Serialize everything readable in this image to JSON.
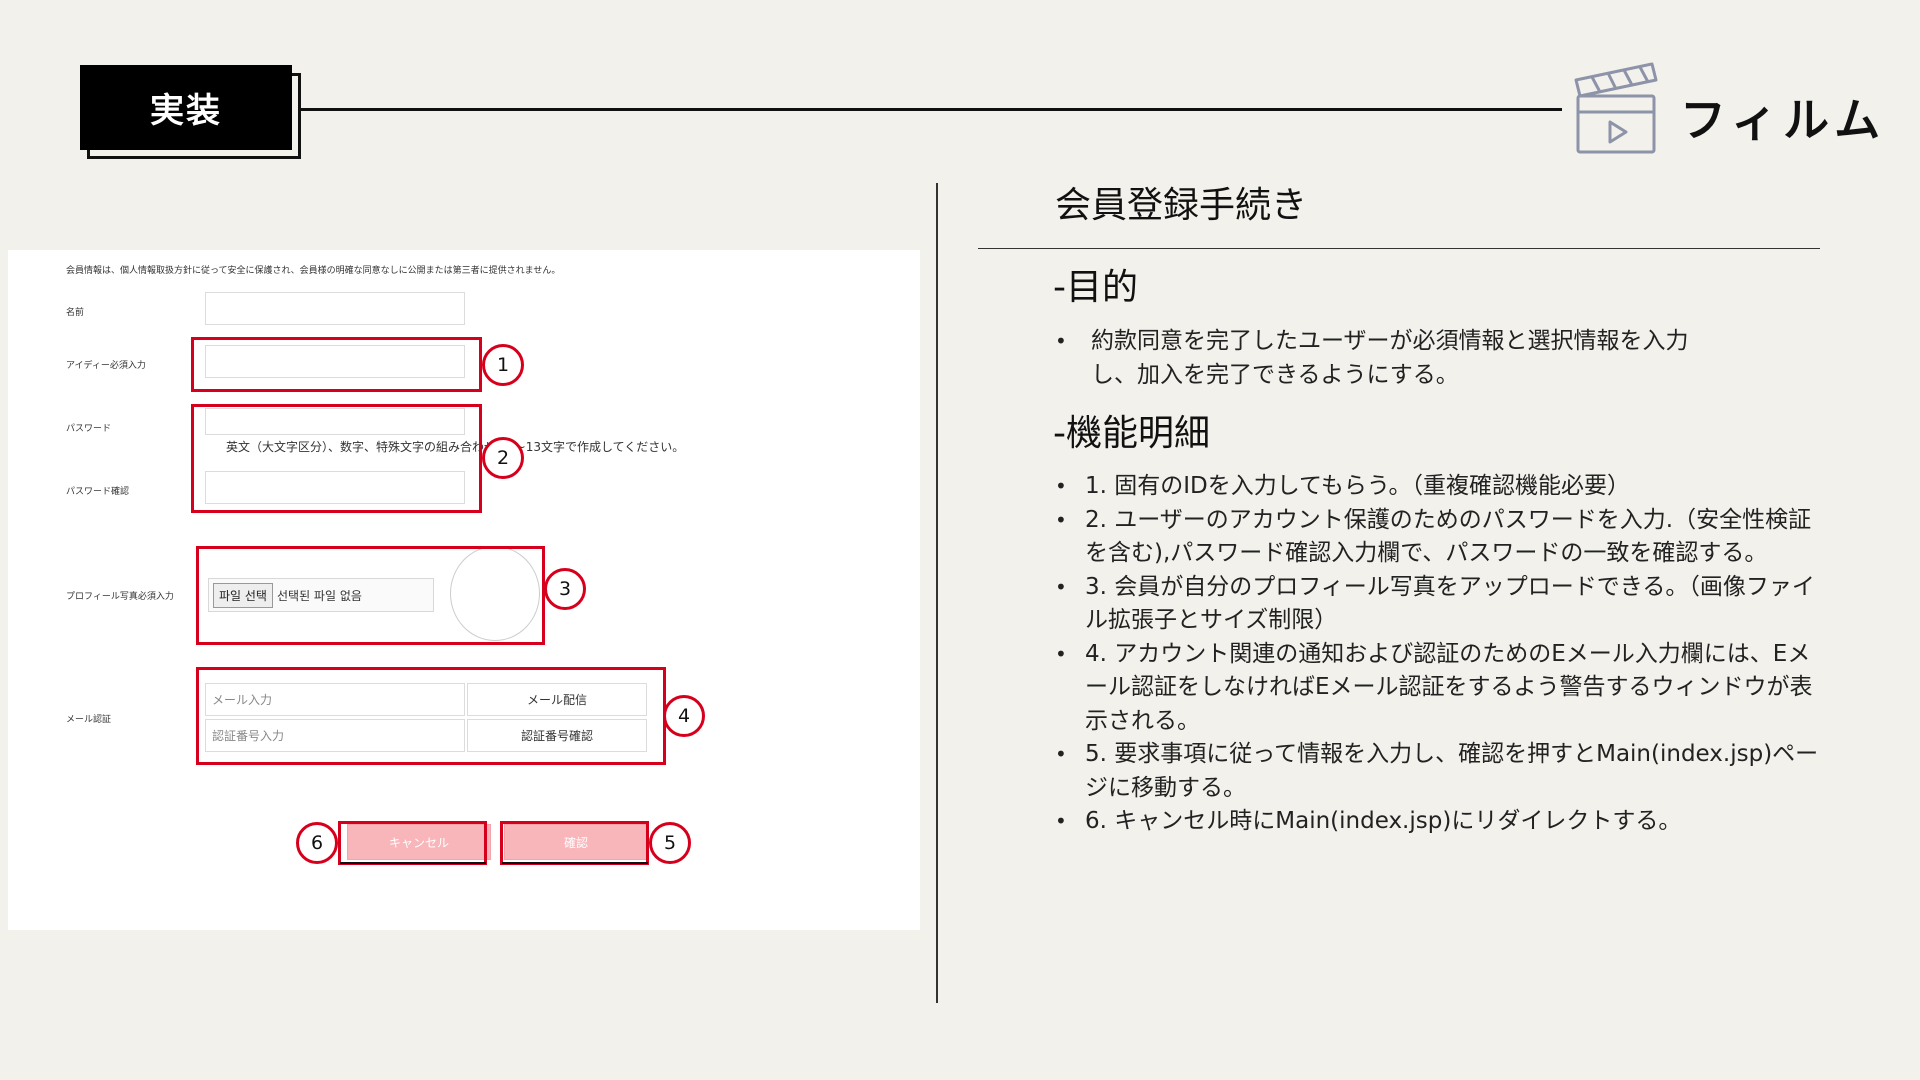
{
  "header": {
    "tag_label": "実装",
    "brand_title": "フィルム"
  },
  "form": {
    "notice": "会員情報は、個人情報取扱方針に従って安全に保護され、会員様の明確な同意なしに公開または第三者に提供されません。",
    "labels": {
      "name": "名前",
      "id": "アイディー必須入力",
      "password": "パスワード",
      "password_confirm": "パスワード確認",
      "profile": "プロフィール写真必須入力",
      "email": "メール認証"
    },
    "password_hint": "英文（大文字区分）、数字、特殊文字の組み合わせで9~13文字で作成してください。",
    "file_button": "파일 선택",
    "file_status": "선택된 파일 없음",
    "email_placeholder": "メール入力",
    "email_send_button": "メール配信",
    "code_placeholder": "認証番号入力",
    "code_confirm_button": "認証番号確認",
    "cancel_button": "キャンセル",
    "confirm_button": "確認"
  },
  "badges": [
    "1",
    "2",
    "3",
    "4",
    "5",
    "6"
  ],
  "doc": {
    "title": "会員登録手続き",
    "purpose_heading": "-目的",
    "purpose_items": [
      "約款同意を完了したユーザーが必須情報と選択情報を入力し、加入を完了できるようにする。"
    ],
    "features_heading": "-機能明細",
    "feature_items": [
      "1. 固有のIDを入力してもらう。（重複確認機能必要）",
      "2. ユーザーのアカウント保護のためのパスワードを入力.（安全性検証を含む),パスワード確認入力欄で、パスワードの一致を確認する。",
      "3. 会員が自分のプロフィール写真をアップロードできる。（画像ファイル拡張子とサイズ制限）",
      "4. アカウント関連の通知および認証のためのEメール入力欄には、Eメール認証をしなければEメール認証をするよう警告するウィンドウが表示される。",
      "5. 要求事項に従って情報を入力し、確認を押すとMain(index.jsp)ページに移動する。",
      "6. キャンセル時にMain(index.jsp)にリダイレクトする。"
    ]
  },
  "colors": {
    "background": "#f3f1ec",
    "annotation_red": "#d6001c",
    "button_pink": "#f8b6bb",
    "icon_gray": "#8d93a8"
  },
  "icons": [
    "clapperboard-icon"
  ]
}
